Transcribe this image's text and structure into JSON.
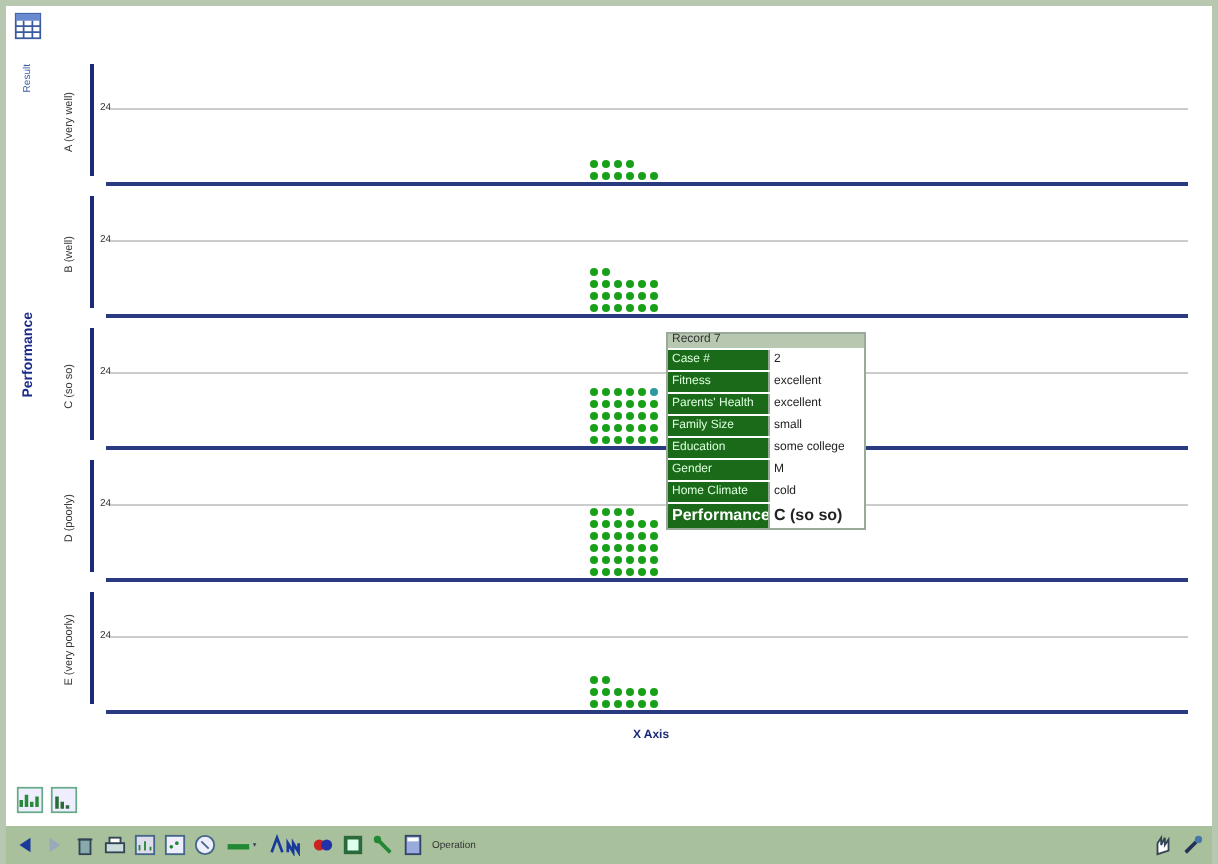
{
  "plot": {
    "top_label": "Result",
    "axis_label": "Performance",
    "x_axis_label": "X Axis",
    "panels": [
      {
        "label": "A (very well)",
        "tick": "24"
      },
      {
        "label": "B (well)",
        "tick": "24"
      },
      {
        "label": "C (so so)",
        "tick": "24"
      },
      {
        "label": "D (poorly)",
        "tick": "24"
      },
      {
        "label": "E (very poorly)",
        "tick": "24"
      }
    ]
  },
  "record_tooltip": {
    "title": "Record 7",
    "rows": [
      {
        "attribute": "Case #",
        "value": "2"
      },
      {
        "attribute": "Fitness",
        "value": "excellent"
      },
      {
        "attribute": "Parents' Health",
        "value": "excellent"
      },
      {
        "attribute": "Family Size",
        "value": "small"
      },
      {
        "attribute": "Education",
        "value": "some college"
      },
      {
        "attribute": "Gender",
        "value": "M"
      },
      {
        "attribute": "Home Climate",
        "value": "cold"
      },
      {
        "attribute": "Performance",
        "value": "C (so so)"
      }
    ]
  },
  "toolbar": {
    "operation_label": "Operation"
  }
}
